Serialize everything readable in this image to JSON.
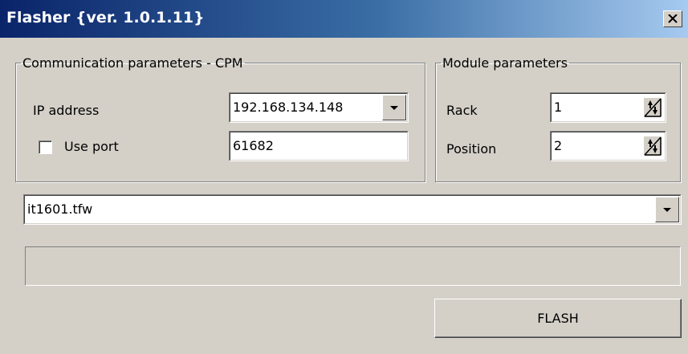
{
  "window": {
    "title": "Flasher {ver. 1.0.1.11}",
    "close_icon": "close-icon"
  },
  "communication": {
    "legend": "Communication parameters - CPM",
    "ip_label": "IP address",
    "ip_value": "192.168.134.148",
    "use_port_label": "Use port",
    "use_port_checked": false,
    "port_value": "61682"
  },
  "module": {
    "legend": "Module parameters",
    "rack_label": "Rack",
    "rack_value": "1",
    "position_label": "Position",
    "position_value": "2"
  },
  "file": {
    "selected": "it1601.tfw"
  },
  "progress": {
    "value": 0
  },
  "actions": {
    "flash_label": "FLASH"
  },
  "colors": {
    "face": "#d4d0c8",
    "title_start": "#0a246a",
    "title_end": "#a6caf0"
  }
}
